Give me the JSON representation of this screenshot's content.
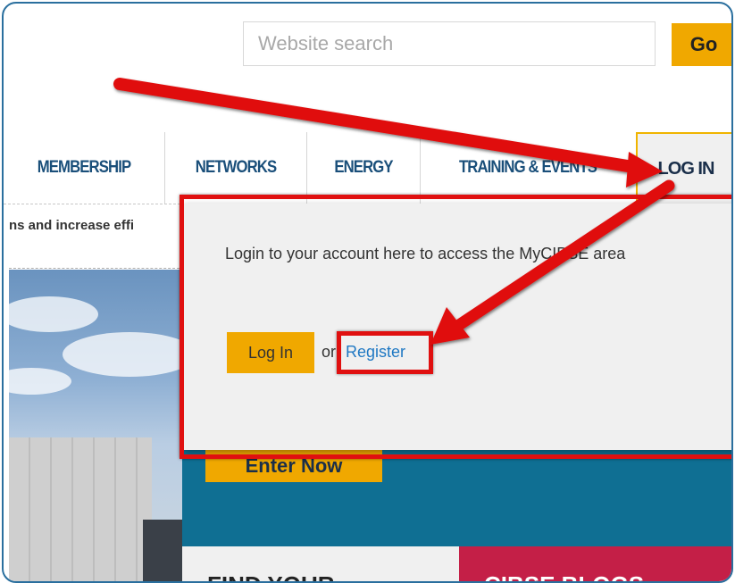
{
  "search": {
    "placeholder": "Website search",
    "go_label": "Go"
  },
  "nav": {
    "items": [
      {
        "label": "MEMBERSHIP"
      },
      {
        "label": "NETWORKS"
      },
      {
        "label": "ENERGY"
      },
      {
        "label": "TRAINING & EVENTS"
      }
    ],
    "login_label": "LOG IN"
  },
  "tagline": "ns and increase effi",
  "login_dropdown": {
    "message": "Login to your account here to access the MyCIBSE area",
    "login_button": "Log In",
    "or_text": "or",
    "register_link": "Register"
  },
  "promo": {
    "enter_button": "Enter Now",
    "find_card": "FIND YOUR",
    "blogs_card": "CIBSE BLOGS"
  },
  "colors": {
    "accent_yellow": "#f0a800",
    "nav_blue": "#1a4f7a",
    "teal": "#0f6f93",
    "crimson": "#c41f47",
    "annotation_red": "#e01010",
    "frame_blue": "#2a6f9e"
  }
}
